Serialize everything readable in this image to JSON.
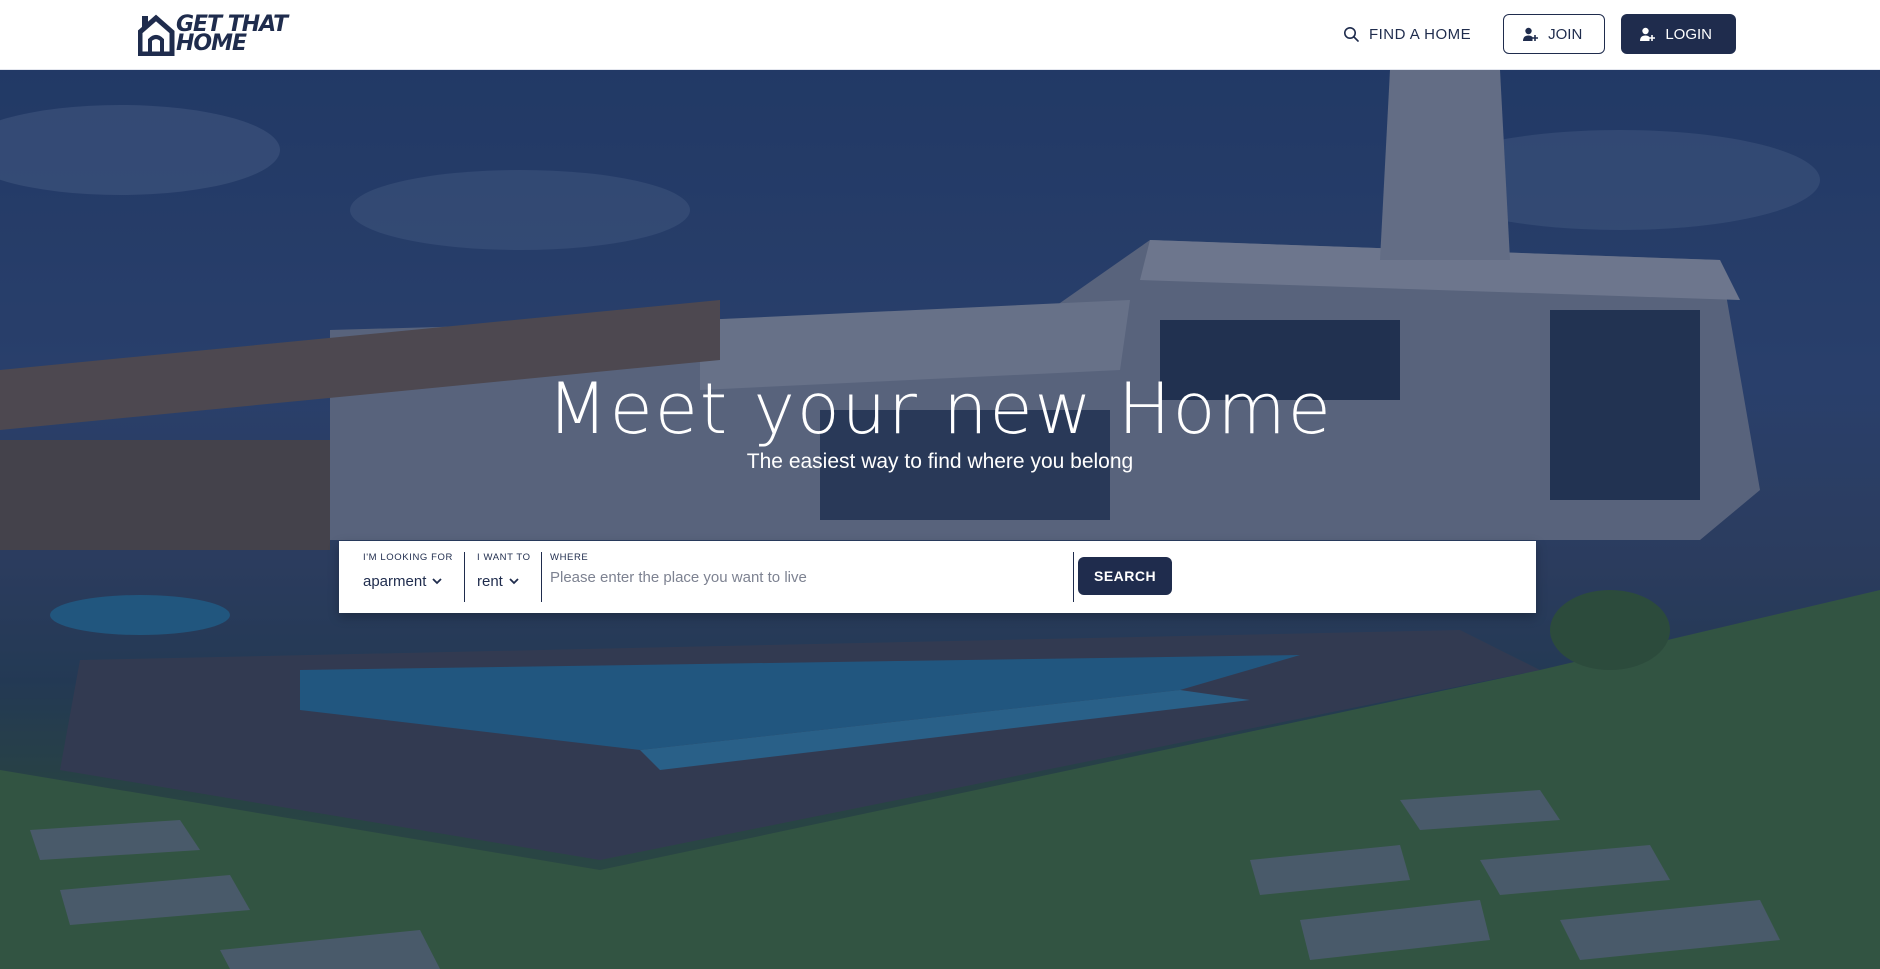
{
  "brand": {
    "logo_line1": "GET THAT",
    "logo_line2": "HOME"
  },
  "nav": {
    "find_label": "FIND A HOME",
    "join_label": "JOIN",
    "login_label": "LOGIN"
  },
  "hero": {
    "title": "Meet your new Home",
    "subtitle": "The easiest way to find where you belong"
  },
  "search": {
    "looking_for_label": "I'M LOOKING FOR",
    "looking_for_value": "aparment",
    "want_to_label": "I WANT TO",
    "want_to_value": "rent",
    "where_label": "WHERE",
    "where_placeholder": "Please enter the place you want to live",
    "button_label": "SEARCH"
  },
  "colors": {
    "brand_navy": "#1f2c4d",
    "overlay": "#16264e"
  },
  "icons": [
    "house-logo-icon",
    "search-icon",
    "user-plus-icon",
    "chevron-down-icon"
  ]
}
